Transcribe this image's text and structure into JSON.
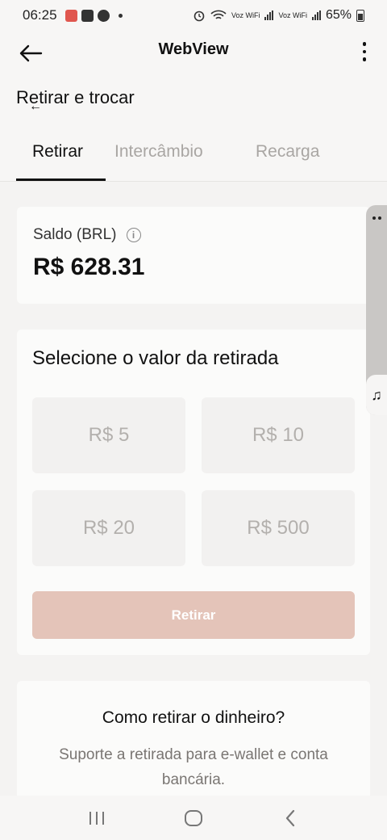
{
  "status_bar": {
    "time": "06:25",
    "network_label": "Voz WiFi",
    "battery": "65%"
  },
  "app_bar": {
    "title": "WebView"
  },
  "page": {
    "title": "Retirar e trocar",
    "tabs": [
      {
        "label": "Retirar",
        "active": true
      },
      {
        "label": "Intercâmbio",
        "active": false
      },
      {
        "label": "Recarga",
        "active": false
      }
    ]
  },
  "balance": {
    "label": "Saldo (BRL)",
    "value": "R$ 628.31"
  },
  "withdraw": {
    "title": "Selecione o valor da retirada",
    "amounts": [
      "R$ 5",
      "R$ 10",
      "R$ 20",
      "R$ 500"
    ],
    "button_label": "Retirar"
  },
  "how_to": {
    "title": "Como retirar o dinheiro?",
    "description": "Suporte a retirada para e-wallet e conta bancária."
  },
  "colors": {
    "accent_disabled": "#e4c4b9",
    "background": "#f4f3f2",
    "card": "#fbfbfa"
  },
  "icons": {
    "back": "arrow-left-icon",
    "more": "more-vertical-icon",
    "info": "info-icon",
    "music": "music-note-icon",
    "nav_recent": "recent-apps-icon",
    "nav_home": "home-icon",
    "nav_back": "back-chevron-icon"
  }
}
